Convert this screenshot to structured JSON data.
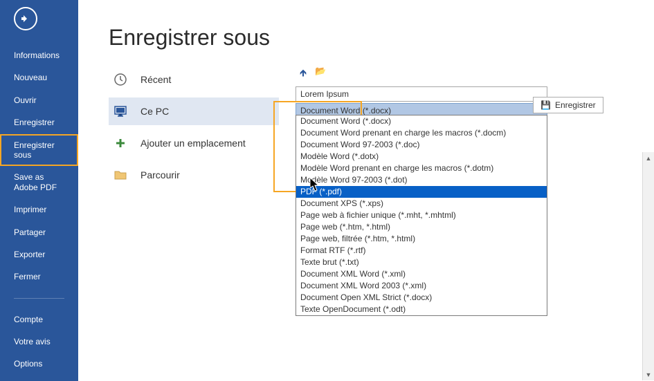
{
  "sidebar": {
    "items": [
      {
        "label": "Informations"
      },
      {
        "label": "Nouveau"
      },
      {
        "label": "Ouvrir"
      },
      {
        "label": "Enregistrer"
      },
      {
        "label": "Enregistrer sous",
        "selected": true
      },
      {
        "label": "Save as Adobe PDF"
      },
      {
        "label": "Imprimer"
      },
      {
        "label": "Partager"
      },
      {
        "label": "Exporter"
      },
      {
        "label": "Fermer"
      }
    ],
    "lower": [
      {
        "label": "Compte"
      },
      {
        "label": "Votre avis"
      },
      {
        "label": "Options"
      }
    ]
  },
  "page": {
    "title": "Enregistrer sous",
    "locations": [
      {
        "label": "Récent",
        "icon": "clock"
      },
      {
        "label": "Ce PC",
        "icon": "monitor",
        "selected": true
      },
      {
        "label": "Ajouter un emplacement",
        "icon": "plus"
      },
      {
        "label": "Parcourir",
        "icon": "folder"
      }
    ],
    "filename": "Lorem Ipsum",
    "format_selected": "Document Word (*.docx)",
    "save_button": "Enregistrer",
    "dropdown": [
      {
        "label": "Document Word (*.docx)"
      },
      {
        "label": "Document Word prenant en charge les macros (*.docm)"
      },
      {
        "label": "Document Word 97-2003 (*.doc)"
      },
      {
        "label": "Modèle Word (*.dotx)"
      },
      {
        "label": "Modèle Word prenant en charge les macros (*.dotm)"
      },
      {
        "label": "Modèle Word 97-2003 (*.dot)"
      },
      {
        "label": "PDF (*.pdf)",
        "highlight": true
      },
      {
        "label": "Document XPS (*.xps)"
      },
      {
        "label": "Page web à fichier unique (*.mht, *.mhtml)"
      },
      {
        "label": "Page web (*.htm, *.html)"
      },
      {
        "label": "Page web, filtrée (*.htm, *.html)"
      },
      {
        "label": "Format RTF (*.rtf)"
      },
      {
        "label": "Texte brut (*.txt)"
      },
      {
        "label": "Document XML Word (*.xml)"
      },
      {
        "label": "Document XML Word 2003 (*.xml)"
      },
      {
        "label": "Document Open XML Strict (*.docx)"
      },
      {
        "label": "Texte OpenDocument (*.odt)"
      }
    ]
  }
}
